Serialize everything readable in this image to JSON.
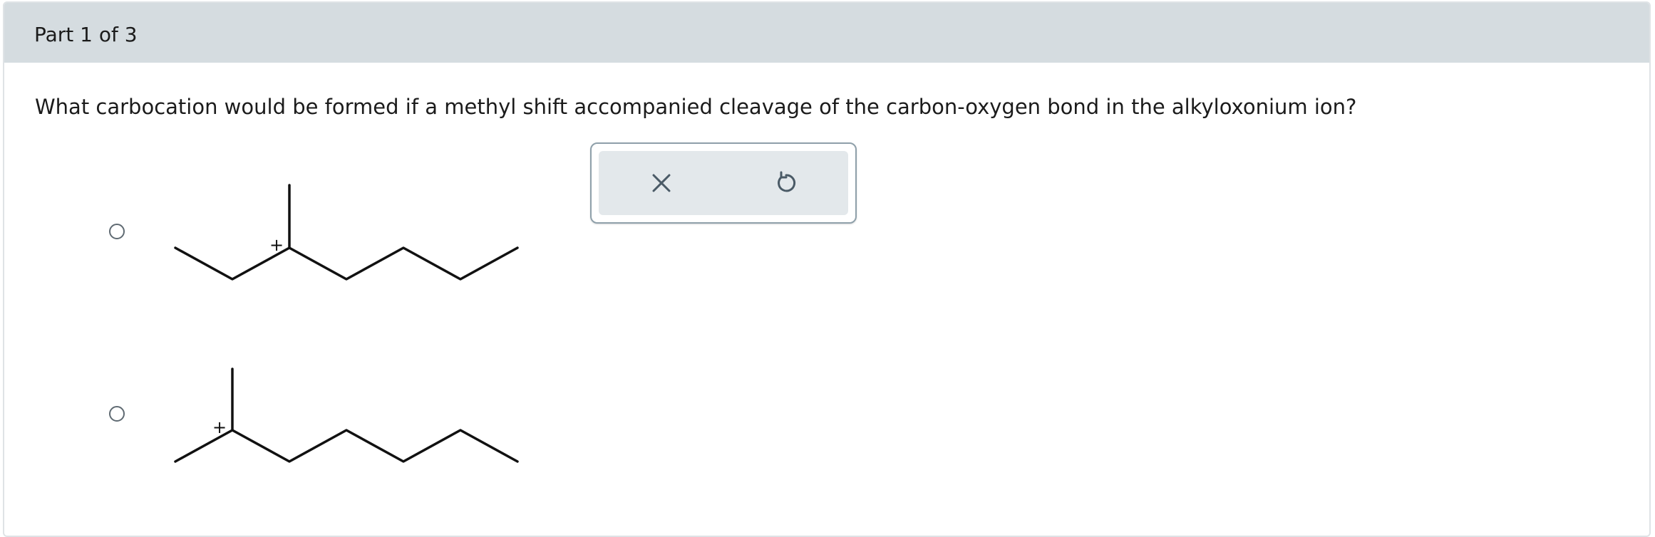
{
  "header": {
    "part_label": "Part 1 of 3"
  },
  "question": {
    "text": "What carbocation would be formed if a methyl shift accompanied cleavage of the carbon-oxygen bond in the alkyloxonium ion?"
  },
  "options": [
    {
      "id": "option-a",
      "charge_label": "+",
      "selected": false
    },
    {
      "id": "option-b",
      "charge_label": "+",
      "selected": false
    }
  ],
  "toolbar": {
    "clear_icon": "close-icon",
    "reset_icon": "undo-icon"
  },
  "colors": {
    "header_bg": "#d5dce0",
    "toolbar_bg": "#e3e8eb",
    "icon_color": "#4a5a66"
  }
}
